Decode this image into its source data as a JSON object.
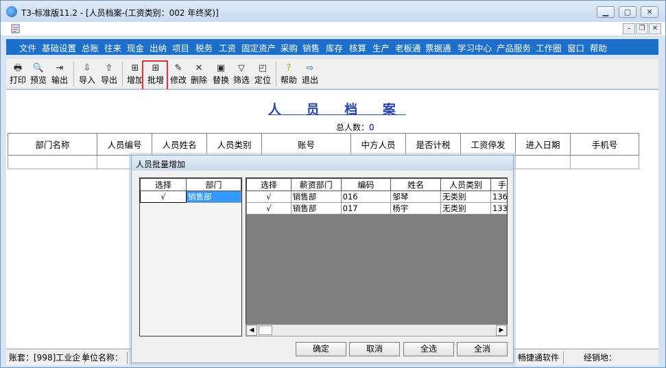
{
  "window": {
    "title": "T3-标准版11.2 - [人员档案-(工资类别：002 年终奖)]"
  },
  "menu": [
    "文件",
    "基础设置",
    "总账",
    "往来",
    "现金",
    "出纳",
    "项目",
    "税务",
    "工资",
    "固定资产",
    "采购",
    "销售",
    "库存",
    "核算",
    "生产",
    "老板通",
    "票据通",
    "学习中心",
    "产品服务",
    "工作圈",
    "窗口",
    "帮助"
  ],
  "toolbar": [
    {
      "label": "打印",
      "icon": "printer-icon"
    },
    {
      "label": "预览",
      "icon": "preview-icon"
    },
    {
      "label": "输出",
      "icon": "export-icon"
    },
    {
      "label": "导入",
      "icon": "import-icon"
    },
    {
      "label": "导出",
      "icon": "export-out-icon"
    },
    {
      "label": "增加",
      "icon": "add-icon"
    },
    {
      "label": "批增",
      "icon": "batch-add-icon"
    },
    {
      "label": "修改",
      "icon": "edit-icon"
    },
    {
      "label": "删除",
      "icon": "delete-icon"
    },
    {
      "label": "替换",
      "icon": "replace-icon"
    },
    {
      "label": "筛选",
      "icon": "filter-icon"
    },
    {
      "label": "定位",
      "icon": "locate-icon"
    },
    {
      "label": "帮助",
      "icon": "help-icon"
    },
    {
      "label": "退出",
      "icon": "exit-icon"
    }
  ],
  "page": {
    "title": "人 员 档 案",
    "total_label": "总人数：",
    "total_value": "0"
  },
  "grid_columns": [
    "部门名称",
    "人员编号",
    "人员姓名",
    "人员类别",
    "账号",
    "中方人员",
    "是否计税",
    "工资停发",
    "进入日期",
    "手机号"
  ],
  "dialog": {
    "title": "人员批量增加",
    "left_columns": [
      "选择",
      "部门"
    ],
    "left_rows": [
      {
        "select": "√",
        "dept": "销售部"
      }
    ],
    "right_columns": [
      "选择",
      "薪资部门",
      "编码",
      "姓名",
      "人员类别",
      "手"
    ],
    "right_rows": [
      {
        "select": "√",
        "dept": "销售部",
        "code": "016",
        "name": "邹琴",
        "category": "无类别",
        "phone": "136"
      },
      {
        "select": "√",
        "dept": "销售部",
        "code": "017",
        "name": "杨宇",
        "category": "无类别",
        "phone": "133"
      }
    ],
    "buttons": {
      "ok": "确定",
      "cancel": "取消",
      "select_all": "全选",
      "deselect_all": "全消"
    }
  },
  "status": {
    "account": "账套：[998]工业企",
    "unit": "单位名称：",
    "vendor": "畅捷通软件",
    "dealer": "经销地："
  },
  "colors": {
    "menu_bg": "#1c70c9",
    "title_color": "#2a44b0",
    "highlight": "#e3312f",
    "selection": "#3399ff"
  }
}
